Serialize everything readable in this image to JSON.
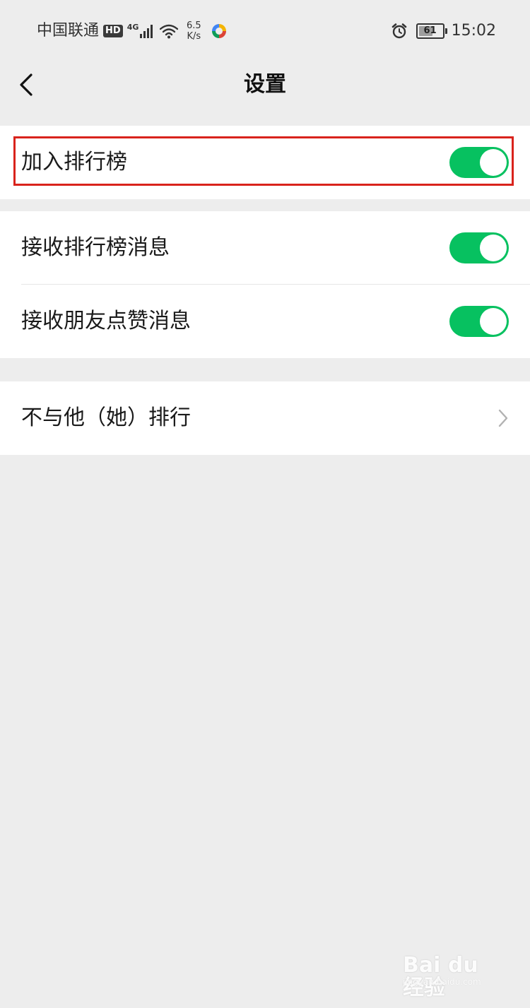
{
  "status_bar": {
    "carrier": "中国联通",
    "hd_badge": "HD",
    "network_type": "4G",
    "speed_value": "6.5",
    "speed_unit": "K/s",
    "battery_level": "61",
    "battery_fraction": 0.61,
    "time": "15:02"
  },
  "nav": {
    "title": "设置"
  },
  "groups": [
    {
      "items": [
        {
          "label": "加入排行榜",
          "control": "switch",
          "on": true
        }
      ]
    },
    {
      "items": [
        {
          "label": "接收排行榜消息",
          "control": "switch",
          "on": true
        },
        {
          "label": "接收朋友点赞消息",
          "control": "switch",
          "on": true
        }
      ]
    },
    {
      "items": [
        {
          "label": "不与他（她）排行",
          "control": "chevron"
        }
      ]
    }
  ],
  "watermark": {
    "brand": "Bai du 经验",
    "domain": "jingyan.baidu.com"
  },
  "colors": {
    "background": "#ededed",
    "switch_on": "#07c160",
    "highlight": "#d9231c"
  }
}
